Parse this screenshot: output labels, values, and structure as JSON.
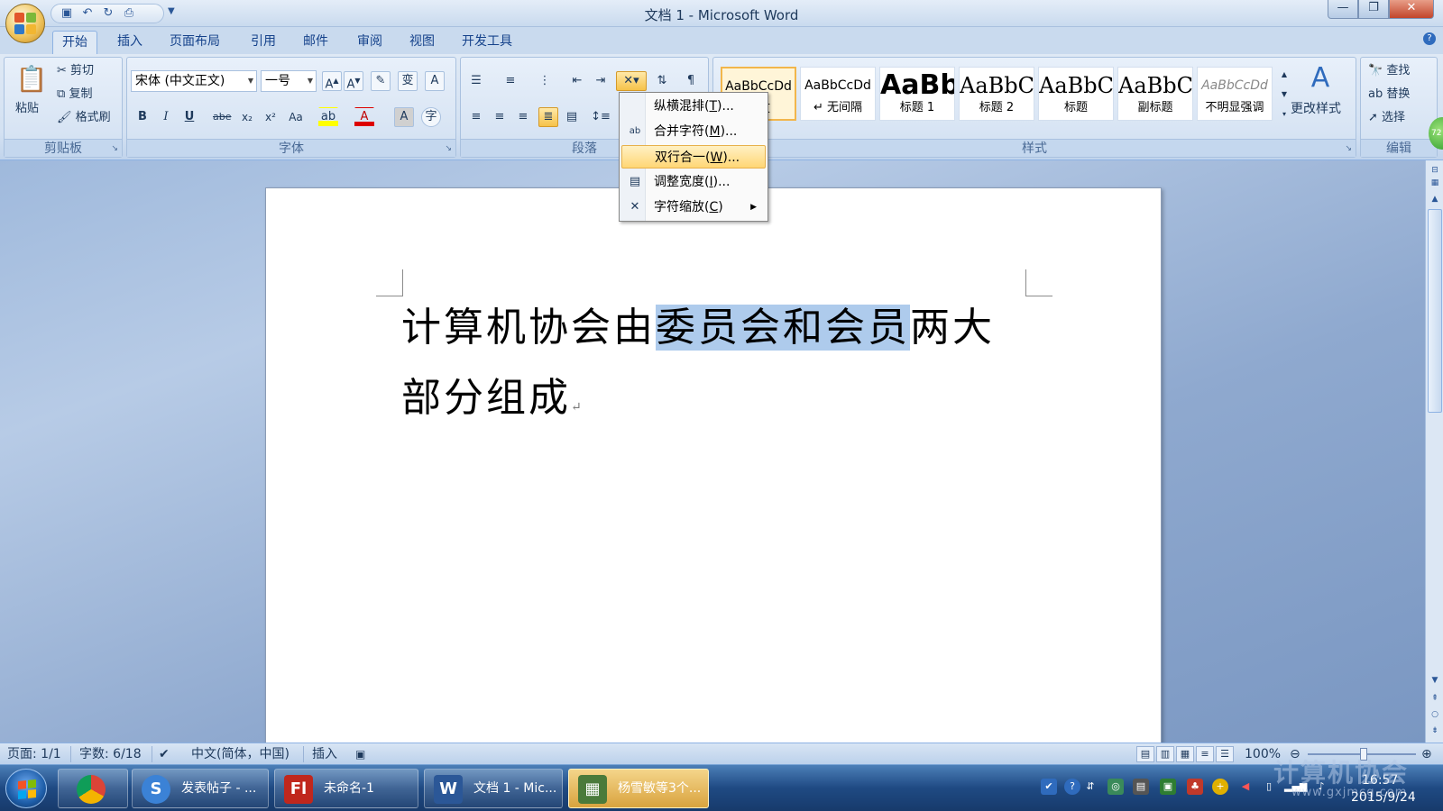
{
  "window": {
    "title": "文档 1 - Microsoft Word",
    "controls": {
      "minimize": "—",
      "maximize": "❐",
      "close": "✕"
    }
  },
  "quick_access": {
    "save_icon": "save-icon",
    "undo_icon": "undo-icon",
    "redo_icon": "redo-icon",
    "preview_icon": "print-preview-icon"
  },
  "tabs": [
    "开始",
    "插入",
    "页面布局",
    "引用",
    "邮件",
    "审阅",
    "视图",
    "开发工具"
  ],
  "active_tab": "开始",
  "ribbon": {
    "clipboard": {
      "label": "剪贴板",
      "paste": "粘贴",
      "cut": "剪切",
      "copy": "复制",
      "format_painter": "格式刷"
    },
    "font": {
      "label": "字体",
      "font_name": "宋体 (中文正文)",
      "font_size": "一号"
    },
    "paragraph": {
      "label": "段落"
    },
    "styles": {
      "label": "样式",
      "items": [
        {
          "sample": "AaBbCcDd",
          "name": "正文"
        },
        {
          "sample": "AaBbCcDd",
          "name": "↵ 无间隔"
        },
        {
          "sample": "AaBb",
          "name": "标题 1"
        },
        {
          "sample": "AaBbC",
          "name": "标题 2"
        },
        {
          "sample": "AaBbC",
          "name": "标题"
        },
        {
          "sample": "AaBbC",
          "name": "副标题"
        },
        {
          "sample": "AaBbCcDd",
          "name": "不明显强调"
        }
      ],
      "change_styles": "更改样式"
    },
    "editing": {
      "label": "编辑",
      "find": "查找",
      "replace": "替换",
      "select": "选择"
    }
  },
  "menu": {
    "items": [
      {
        "label": "纵横混排",
        "key": "T",
        "suffix": ")...",
        "icon": "",
        "hover": false
      },
      {
        "label": "合并字符",
        "key": "M",
        "suffix": ")...",
        "icon": "ab",
        "hover": false
      },
      {
        "label": "双行合一",
        "key": "W",
        "suffix": ")...",
        "icon": "",
        "hover": true
      },
      {
        "label": "调整宽度",
        "key": "I",
        "suffix": ")...",
        "icon": "▤",
        "hover": false
      },
      {
        "label": "字符缩放",
        "key": "C",
        "suffix": ")",
        "icon": "✕",
        "hover": false,
        "submenu": true
      }
    ]
  },
  "document": {
    "text_before": "计算机协会由",
    "text_selected": "委员会和会员",
    "text_after": "两大部分组成",
    "para_mark": "↵"
  },
  "status": {
    "page": "页面: 1/1",
    "words": "字数: 6/18",
    "language": "中文(简体，中国)",
    "mode": "插入",
    "zoom": "100%"
  },
  "taskbar": {
    "items": [
      {
        "label": "发表帖子 - ...",
        "icon": "S",
        "color": "#3b82d6"
      },
      {
        "label": "未命名-1",
        "icon": "Fl",
        "color": "#c0271d"
      },
      {
        "label": "文档 1 - Mic...",
        "icon": "W",
        "color": "#2b5797"
      },
      {
        "label": "杨雪敏等3个...",
        "icon": "▦",
        "color": "#4a7a3a"
      }
    ],
    "time": "16:57",
    "date": "2015/9/24"
  },
  "watermark": {
    "text": "计算机协会",
    "url": "www.gxjmcg.com"
  }
}
